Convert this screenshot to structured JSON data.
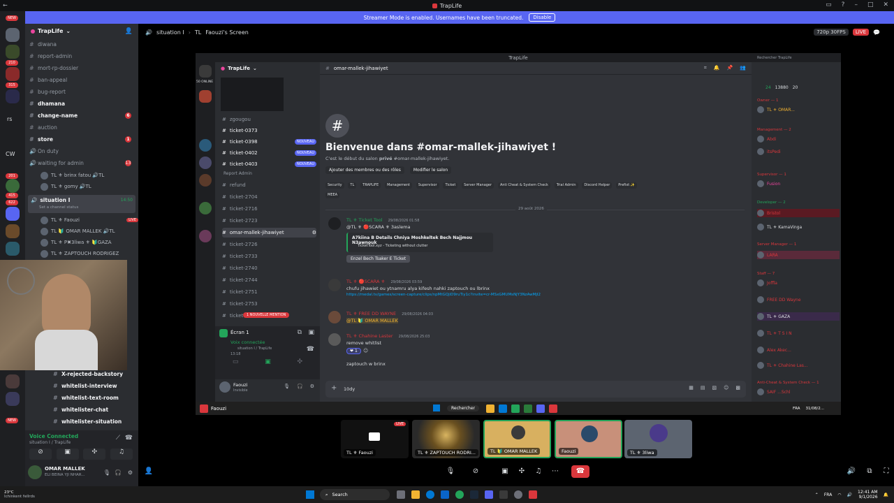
{
  "app_title": "TrapLife",
  "streamer_banner": {
    "text": "Streamer Mode is enabled. Usernames have been truncated.",
    "button": "Disable"
  },
  "rail_badges": [
    "NEW",
    "210",
    "315",
    "201",
    "415",
    "622",
    "NEW"
  ],
  "rail_letters": [
    "rs",
    "CW"
  ],
  "server": {
    "name": "TrapLife"
  },
  "channels": [
    {
      "label": "diwana",
      "bold": false
    },
    {
      "label": "report-admin",
      "bold": false
    },
    {
      "label": "mort-rp-dossier",
      "bold": false
    },
    {
      "label": "ban-appeal",
      "bold": false
    },
    {
      "label": "bug-report",
      "bold": false
    },
    {
      "label": "dhamana",
      "bold": true
    },
    {
      "label": "change-name",
      "bold": true,
      "badge": "6"
    },
    {
      "label": "auction",
      "bold": false
    },
    {
      "label": "store",
      "bold": true,
      "badge": "1"
    },
    {
      "label": "On duty",
      "bold": false
    },
    {
      "label": "waiting for admin",
      "bold": false,
      "badge": "13"
    }
  ],
  "waiting_users": [
    "TL ⚜ brinx fatou 🔊TL",
    "TL ⚜ gomy 🔊TL"
  ],
  "voice_channel": {
    "label": "situation I",
    "time": "14:50",
    "status": "Set a channel status"
  },
  "voice_users": [
    {
      "name": "TL ⚜ Faouzi",
      "badge": "LIVE"
    },
    {
      "name": "TL 🔰 OMAR MALLEK 🔊TL"
    },
    {
      "name": "TL ⚜ P✖3liwa ⚜ 🔰GAZA"
    },
    {
      "name": "TL ⚜ ZAPTOUCH RODRIGEZ"
    }
  ],
  "lower_channels": [
    "X-rejected-backstory",
    "whitelist-interview",
    "whitelist-text-room",
    "whitelister-chat",
    "whitelister-situation"
  ],
  "voice_connected": {
    "title": "Voice Connected",
    "sub": "situation I / TrapLife"
  },
  "self_user": {
    "name": "OMAR MALLEK",
    "status": "ELI BEINA YJI NHAR..."
  },
  "stream_header": {
    "channel": "situation I",
    "server": "TL",
    "screen": "Faouzi's Screen",
    "quality": "720p 30FPS",
    "live": "LIVE"
  },
  "inner": {
    "title": "TrapLife",
    "server": "TrapLife",
    "online": "50 ONLINE",
    "channel": "omar-mallek-jihawiyet",
    "search_placeholder": "Rechercher TrapLife",
    "channels_top": [
      {
        "label": "zgougou"
      },
      {
        "label": "ticket-0373"
      },
      {
        "label": "ticket-0398",
        "badge": "NOUVEAU"
      },
      {
        "label": "ticket-0402",
        "badge": "NOUVEAU"
      },
      {
        "label": "ticket-0403",
        "badge": "NOUVEAU"
      }
    ],
    "report_admin": "Report Admin",
    "channels_bottom": [
      "refund",
      "ticket-2704",
      "ticket-2716",
      "ticket-2723",
      "omar-mallek-jihawiyet",
      "ticket-2726",
      "ticket-2733",
      "ticket-2740",
      "ticket-2744",
      "ticket-2751",
      "ticket-2753",
      "ticket"
    ],
    "nouvelle_mention": "1 NOUVELLE MENTION",
    "ecran": "Écran 1",
    "voix": "Voix connectée",
    "voix_sub": "situation I / TrapLife",
    "voix_time": "13:18",
    "self": "Faouzi",
    "self_status": "Invisible",
    "welcome_title": "Bienvenue dans #omar-mallek-jihawiyet !",
    "welcome_sub_pre": "C'est le début du salon",
    "welcome_sub_bold": "privé",
    "welcome_sub_post": "#omar-mallek-jihawiyet.",
    "add_members": "Ajouter des membres ou des rôles",
    "edit_channel": "Modifier le salon",
    "tags": [
      "Security",
      "TL",
      "TRAPLIFE",
      "Management",
      "Supervisor",
      "Ticket",
      "Server Manager",
      "Anti Cheat & System Check",
      "Trial Admin",
      "Discord Helper",
      "Prefixt ✨",
      "MEEA"
    ],
    "date_divider": "29 août 2026",
    "messages": [
      {
        "author": "TL ⚜ Ticket Tool",
        "time": "29/08/2026 01:58",
        "line1": "@TL ⚜ 🔴SCARA ⚜ 3aslema",
        "embed_title": "A7kiina B Details Chniya Moshkeltek Bech Najjmou N3awnouk",
        "embed_sub": "TicketTool.xyz - Ticketing without clutter",
        "button": "Enzel Bech Tsaker E Ticket"
      },
      {
        "author": "TL ⚜ 🔴SCARA ⚜",
        "time": "29/08/2026 03:59",
        "line1": "chufu jihawiet ou ytnamru alya kifesh nahki zaptouch ou lbrinx",
        "link": "https://medal.tv/games/screen-capture/clips/npMtGQjiD9ruTiy1c?invite=cr-MSxGMUMsNjY3NzAwMjI2"
      },
      {
        "author": "TL ⚜ FREE DD WAYNE",
        "time": "29/08/2026 04:03",
        "line1": "@TL 🔰 OMAR MALLEK"
      },
      {
        "author": "TL ⚜ Chahine Laster",
        "time": "29/08/2026 25:03",
        "line1": "remove whitlist",
        "line2": "zaptouch w brinx"
      }
    ],
    "reaction": "1",
    "composer": "10dy",
    "member_counts": {
      "a": "24",
      "b": "13880",
      "c": "20"
    },
    "member_groups": [
      {
        "role": "Owner — 1",
        "members": [
          "TL ⚜ OMAR..."
        ]
      },
      {
        "role": "Management — 2",
        "members": [
          "Abdi",
          "itsPedi"
        ]
      },
      {
        "role": "Supervisor — 1",
        "members": [
          "Fusion"
        ]
      },
      {
        "role": "Developer — 2",
        "members": [
          "Bristol",
          "TL ⚜ KamaVinga"
        ]
      },
      {
        "role": "Server Manager — 1",
        "members": [
          "LARA"
        ]
      },
      {
        "role": "Staff — 7",
        "members": [
          "Joffla",
          "FREE DD Wayne",
          "TL ⚜ GAZA",
          "TL ⚜ T S I N",
          "Alex Akec...",
          "TL ⚜ Chahine Las..."
        ]
      },
      {
        "role": "Anti-Cheat & System Check — 1",
        "members": [
          "SAIF ...Schl"
        ]
      }
    ],
    "taskbar_user": "Faouzi",
    "taskbar_search": "Rechercher",
    "taskbar_lang": "FRA",
    "taskbar_date": "31/08/2..."
  },
  "tiles": [
    {
      "label": "TL ⚜ Faouzi",
      "live": "LIVE"
    },
    {
      "label": "TL ⚜ ZAPTOUCH RODRI..."
    },
    {
      "label": "TL 🔰 OMAR MALLEK"
    },
    {
      "label": "Faouzi"
    },
    {
      "label": "TL ⚜ 3liwa"
    }
  ],
  "windows_taskbar": {
    "weather_temp": "23°C",
    "weather_desc": "Ichinkent fellrds",
    "search": "Search",
    "lang": "FRA",
    "time": "12:41 AM",
    "date": "9/1/2026"
  },
  "colors": {
    "blurple": "#5865f2",
    "red": "#da373c",
    "green": "#23a55a",
    "bg": "#313338",
    "sidebar": "#2b2d31"
  }
}
